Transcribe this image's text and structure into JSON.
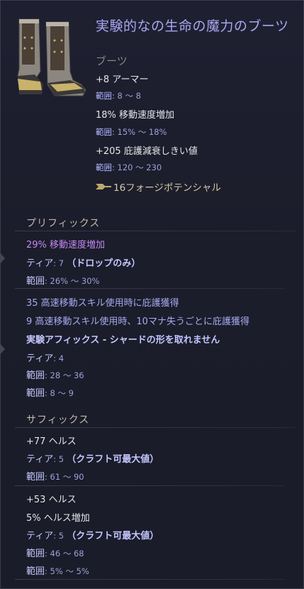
{
  "item": {
    "title": "実験的なの生命の魔力のブーツ",
    "type": "ブーツ"
  },
  "implicits": [
    {
      "stat": "+8 アーマー",
      "range_label": "範囲",
      "range_value": ": 8 〜 8"
    },
    {
      "stat": "18% 移動速度増加",
      "range_label": "範囲",
      "range_value": ": 15% 〜 18%"
    },
    {
      "stat": "+205 庇護減衰しきい値",
      "range_label": "範囲",
      "range_value": ": 120 〜 230"
    }
  ],
  "forge_potential": "16フォージポテンシャル",
  "prefix_section": {
    "title": "プリフィックス",
    "affix1": {
      "stat": "29% 移動速度増加",
      "tier_label": "ティア",
      "tier_value": ": 7",
      "tier_note": "（ドロップのみ）",
      "range_label": "範囲",
      "range_value": ": 26% 〜 30%"
    },
    "affix2": {
      "stat1": "35 高速移動スキル使用時に庇護獲得",
      "stat2": "9 高速移動スキル使用時、10マナ失うごとに庇護獲得",
      "note": "実験アフィックス - シャードの形を取れません",
      "tier_label": "ティア",
      "tier_value": ": 4",
      "range1_label": "範囲",
      "range1_value": ": 28 〜 36",
      "range2_label": "範囲",
      "range2_value": ": 8 〜 9"
    }
  },
  "suffix_section": {
    "title": "サフィックス",
    "affix1": {
      "stat": "+77 ヘルス",
      "tier_label": "ティア",
      "tier_value": ": 5",
      "tier_note": "（クラフト可最大値）",
      "range_label": "範囲",
      "range_value": ": 61 〜 90"
    },
    "affix2": {
      "stat1": "+53 ヘルス",
      "stat2": "5% ヘルス増加",
      "tier_label": "ティア",
      "tier_value": ": 5",
      "tier_note": "（クラフト可最大値）",
      "range1_label": "範囲",
      "range1_value": ": 46 〜 68",
      "range2_label": "範囲",
      "range2_value": ": 5% 〜 5%"
    }
  },
  "colors": {
    "title": "#a9a6f2",
    "prefix_stat": "#c487f0",
    "affix_stat": "#a8aaf0",
    "background": "#1b1d2c"
  },
  "icons": [
    "boots-icon",
    "forge-hammer-icon",
    "side-gem-icon"
  ]
}
